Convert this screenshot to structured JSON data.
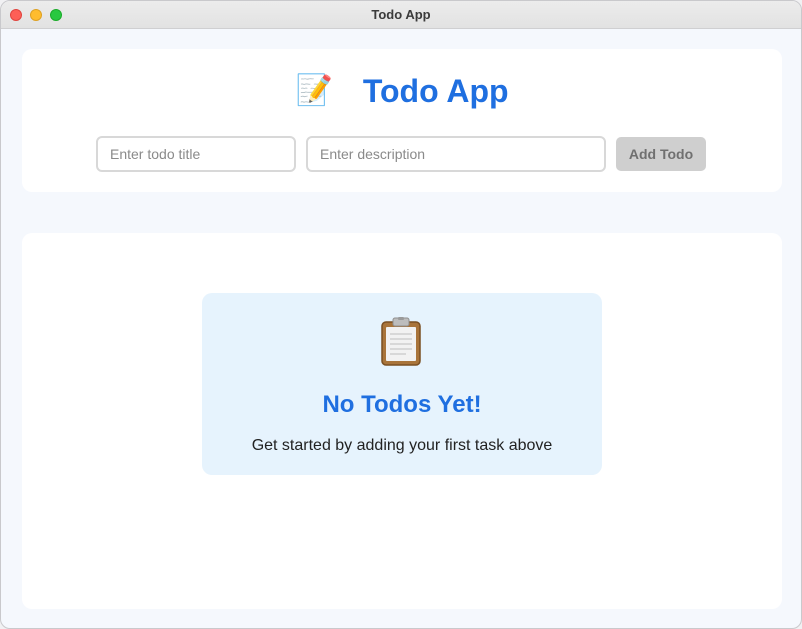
{
  "window": {
    "title": "Todo App"
  },
  "header": {
    "icon": "📝",
    "title": "Todo App",
    "title_placeholder": "Enter todo title",
    "description_placeholder": "Enter description",
    "add_button_label": "Add Todo"
  },
  "empty_state": {
    "icon": "clipboard-icon",
    "title": "No Todos Yet!",
    "subtitle": "Get started by adding your first task above"
  },
  "colors": {
    "accent": "#1f6fe0",
    "empty_bg": "#e6f3fd",
    "button_disabled": "#cfcfcf"
  }
}
